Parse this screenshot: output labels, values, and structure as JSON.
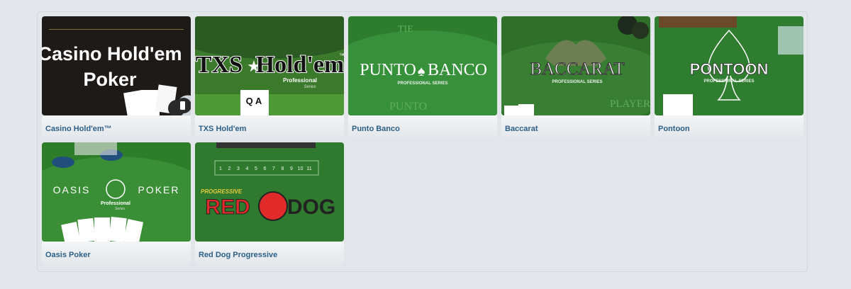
{
  "games": [
    {
      "id": "casino-holdem",
      "caption": "Casino Hold'em™",
      "art": {
        "line1": "Casino Hold'em",
        "line2": "Poker"
      }
    },
    {
      "id": "txs-holdem",
      "caption": "TXS Hold'em",
      "art": {
        "title_left": "TXS",
        "title_right": "Hold'em",
        "tm": "™",
        "sub1": "Professional",
        "sub2": "Series",
        "cards": "Q A"
      }
    },
    {
      "id": "punto-banco",
      "caption": "Punto Banco",
      "art": {
        "title_left": "PUNTO",
        "title_right": "BANCO",
        "series": "PROFESSIONAL SERIES",
        "top": "TIE",
        "bottom": "PUNTO"
      }
    },
    {
      "id": "baccarat",
      "caption": "Baccarat",
      "art": {
        "title": "BACCARAT",
        "series": "PROFESSIONAL SERIES",
        "bottom": "PLAYER"
      }
    },
    {
      "id": "pontoon",
      "caption": "Pontoon",
      "art": {
        "title": "PONTOON",
        "series": "PROFESSIONAL SERIES"
      }
    },
    {
      "id": "oasis-poker",
      "caption": "Oasis Poker",
      "art": {
        "title_left": "OASIS",
        "title_right": "POKER",
        "sub1": "Professional",
        "sub2": "Series"
      }
    },
    {
      "id": "red-dog",
      "caption": "Red Dog Progressive",
      "art": {
        "top": "PROGRESSIVE",
        "title_left": "RED",
        "title_right": "DOG",
        "numbers": [
          "1",
          "2",
          "3",
          "4",
          "5",
          "6",
          "7",
          "8",
          "9",
          "10",
          "11"
        ]
      }
    }
  ],
  "colors": {
    "caption": "#2b5f88",
    "panel": "#e2e6ea",
    "felt": "#2f8a2f"
  },
  "icons": {
    "mobile": "mobile-device-icon"
  }
}
